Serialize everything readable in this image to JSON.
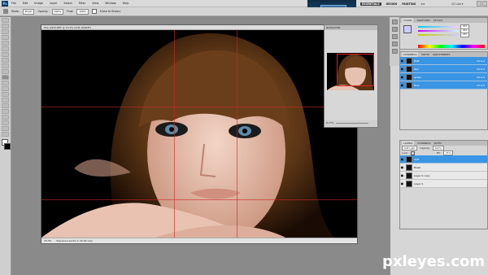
{
  "menubar": {
    "app_badge": "Ps",
    "items": [
      "File",
      "Edit",
      "Image",
      "Layer",
      "Select",
      "Filter",
      "View",
      "Window",
      "Help"
    ],
    "promo_button": "Subscribe"
  },
  "workspaces": {
    "items": [
      "ESSENTIALS",
      "DESIGN",
      "PAINTING"
    ],
    "active": "ESSENTIALS",
    "more": ">>"
  },
  "cslive": "CS Live ▾",
  "options": {
    "mode_label": "Mode:",
    "mode_value": "Brush",
    "opacity_label": "Opacity:",
    "opacity_value": "100%",
    "flow_label": "Flow:",
    "flow_value": "100%",
    "erase_history_label": "Erase to History"
  },
  "document": {
    "title": "PSC_4920.NEF @ 33.3% (Soft, RGB/8*)",
    "zoom": "33.3%",
    "status_info": "Exposure works in 32-bit only"
  },
  "navigator": {
    "tabs": [
      "NAVIGATOR",
      "HISTOGRAM",
      "INFO"
    ],
    "zoom": "8.77%"
  },
  "color_panel": {
    "tabs": [
      "COLOR",
      "SWATCHES",
      "STYLES"
    ],
    "values": [
      "202",
      "204",
      "255"
    ]
  },
  "channels_panel": {
    "tabs": [
      "CHANNELS",
      "PATHS",
      "ADJUSTMENTS"
    ],
    "rows": [
      {
        "name": "RGB",
        "shortcut": "Ctrl+2"
      },
      {
        "name": "Red",
        "shortcut": "Ctrl+3"
      },
      {
        "name": "Green",
        "shortcut": "Ctrl+4"
      },
      {
        "name": "Blue",
        "shortcut": "Ctrl+5"
      }
    ]
  },
  "layers_panel": {
    "tabs": [
      "LAYERS",
      "CHANNELS",
      "PATHS"
    ],
    "blend_mode": "Soft Light",
    "opacity_label": "Opacity:",
    "opacity_value": "100%",
    "lock_label": "Lock:",
    "fill_label": "Fill:",
    "fill_value": "75%",
    "rows": [
      {
        "name": "Soft",
        "selected": true
      },
      {
        "name": "Blush",
        "selected": false
      },
      {
        "name": "Layer 0 copy",
        "selected": false
      },
      {
        "name": "Layer 0",
        "selected": false
      }
    ]
  },
  "watermark": "pxleyes.com",
  "colors": {
    "accent": "#3a95e4",
    "workspace_bg": "#8a8a8a"
  }
}
